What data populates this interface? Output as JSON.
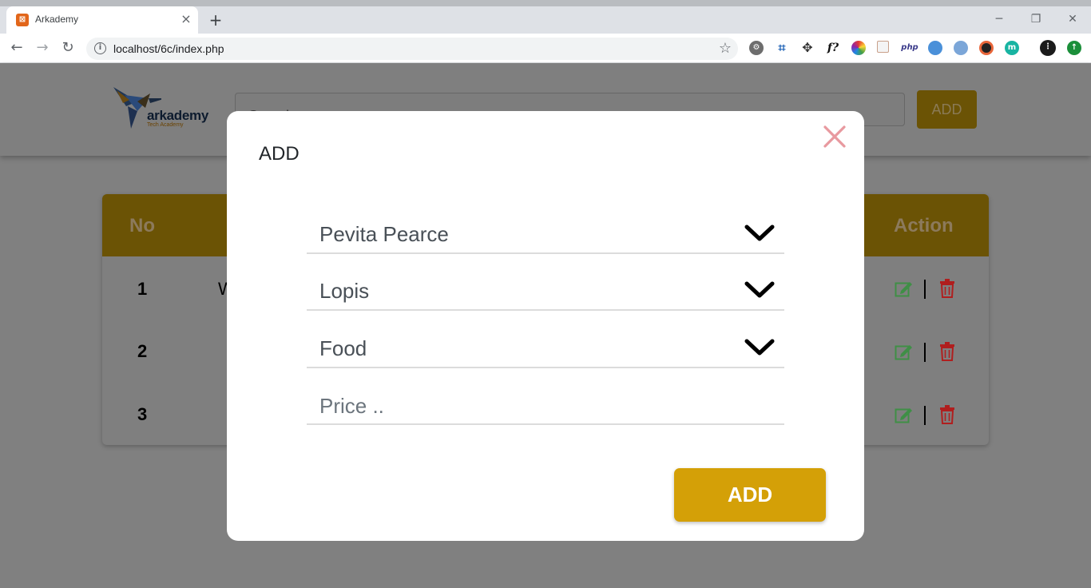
{
  "browser": {
    "tab_title": "Arkademy",
    "url": "localhost/6c/index.php",
    "new_tab_label": "+",
    "tab_close_label": "×",
    "minimize_label": "─",
    "restore_label": "❐",
    "close_label": "✕"
  },
  "header": {
    "logo_text": "arkademy",
    "logo_subtext": "Tech Academy",
    "search_placeholder": "Search ..",
    "add_label": "ADD"
  },
  "table": {
    "columns": [
      "No",
      "Action"
    ],
    "rows": [
      {
        "no": "1",
        "name": "W"
      },
      {
        "no": "2",
        "name": ""
      },
      {
        "no": "3",
        "name": ""
      }
    ]
  },
  "modal": {
    "title": "ADD",
    "cashier_value": "Pevita Pearce",
    "product_value": "Lopis",
    "category_value": "Food",
    "price_placeholder": "Price ..",
    "submit_label": "ADD"
  },
  "colors": {
    "accent": "#d4a007",
    "close_icon": "#e8999f",
    "edit_icon": "#3f8f46",
    "delete_icon": "#b01e1e"
  }
}
